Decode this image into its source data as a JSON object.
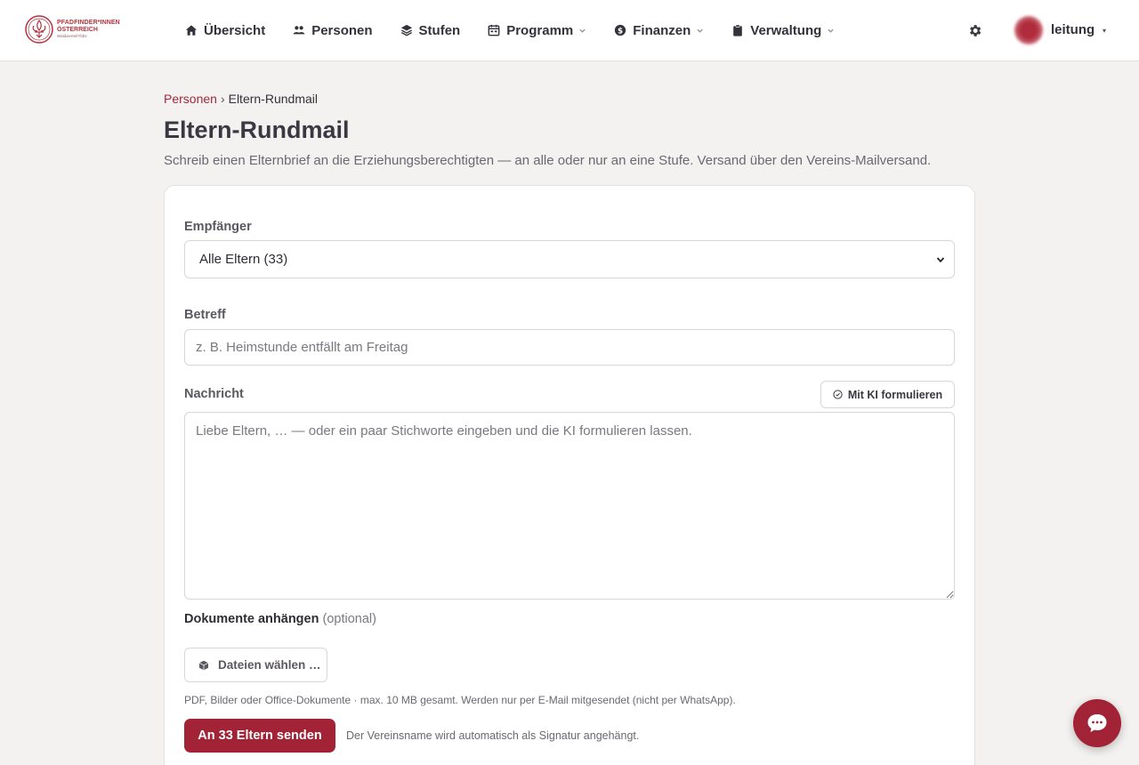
{
  "header": {
    "logo": {
      "line1": "PFADFINDER*INNEN",
      "line2": "ÖSTERREICH",
      "line3": "Waldviertel/Ybbs"
    },
    "nav": [
      {
        "label": "Übersicht",
        "icon": "home-icon",
        "dropdown": false
      },
      {
        "label": "Personen",
        "icon": "users-icon",
        "dropdown": false
      },
      {
        "label": "Stufen",
        "icon": "layers-icon",
        "dropdown": false
      },
      {
        "label": "Programm",
        "icon": "calendar-icon",
        "dropdown": true
      },
      {
        "label": "Finanzen",
        "icon": "dollar-circle-icon",
        "dropdown": true
      },
      {
        "label": "Verwaltung",
        "icon": "clipboard-icon",
        "dropdown": true
      }
    ],
    "user": {
      "name": "leitung",
      "caret": "▾"
    }
  },
  "breadcrumb": {
    "parent": "Personen",
    "separator": "›",
    "current": "Eltern-Rundmail"
  },
  "page": {
    "title": "Eltern-Rundmail",
    "description": "Schreib einen Elternbrief an die Erziehungsberechtigten — an alle oder nur an eine Stufe. Versand über den Vereins-Mailversand."
  },
  "form": {
    "recipients": {
      "label": "Empfänger",
      "value": "Alle Eltern (33)"
    },
    "subject": {
      "label": "Betreff",
      "value": "",
      "placeholder": "z. B. Heimstunde entfällt am Freitag"
    },
    "message": {
      "label": "Nachricht",
      "value": "",
      "placeholder": "Liebe Eltern, … — oder ein paar Stichworte eingeben und die KI formulieren lassen.",
      "ai_button": "Mit KI formulieren"
    },
    "attachments": {
      "label": "Dokumente anhängen",
      "optional": "(optional)",
      "button": "Dateien wählen …",
      "hint": "PDF, Bilder oder Office-Dokumente · max. 10 MB gesamt. Werden nur per E-Mail mitgesendet (nicht per WhatsApp)."
    },
    "send_button": "An 33 Eltern senden",
    "signature_note": "Der Vereinsname wird automatisch als Signatur angehängt."
  },
  "colors": {
    "brand": "#a32336",
    "link": "#a5283a",
    "background": "#f3f2f1"
  }
}
